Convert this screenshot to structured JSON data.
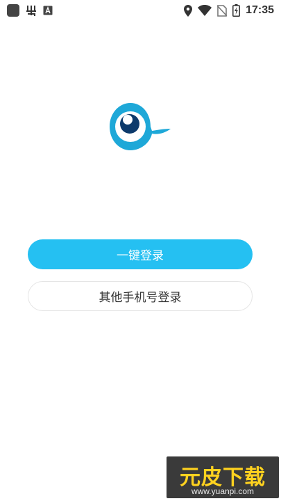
{
  "status_bar": {
    "time": "17:35",
    "left_icons": [
      "app-icon",
      "bug-icon",
      "a-notification-icon"
    ],
    "right_icons": [
      "location-icon",
      "wifi-icon",
      "no-sim-icon",
      "battery-charging-icon"
    ]
  },
  "logo": {
    "icon": "bird-eye-logo-icon",
    "color": "#1ea8d8"
  },
  "buttons": {
    "one_click_login": "一键登录",
    "other_phone_login": "其他手机号登录"
  },
  "watermark": {
    "text": "元皮下载",
    "url": "www.yuanpi.com"
  },
  "colors": {
    "primary": "#25c0f2",
    "secondary_border": "#e5e5e5"
  }
}
